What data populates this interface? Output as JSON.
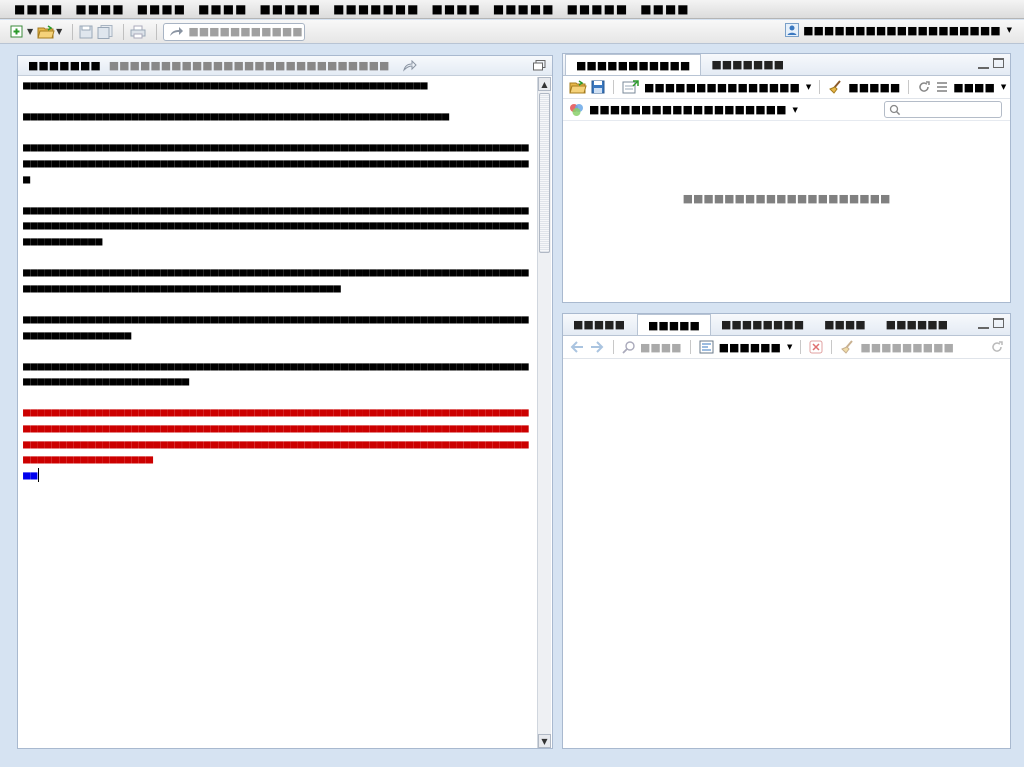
{
  "menubar": {
    "items": [
      "■■■■",
      "■■■■",
      "■■■■",
      "■■■■",
      "■■■■■",
      "■■■■■■■",
      "■■■■",
      "■■■■■",
      "■■■■■",
      "■■■■"
    ]
  },
  "toolbar": {
    "search_placeholder": "■■■■■■■■■■■",
    "user_label": "■■■■■■■■■■■■■■■■■■■"
  },
  "editor": {
    "title": "■■■■■■■",
    "subtitle": "■■■■■■■■■■■■■■■■■■■■■■■■■■■",
    "paragraphs": [
      "■■■■■■■■■■■■■■■■■■■■■■■■■■■■■■■■■■■■■■■■■■■■■■■■■■■■■■■■",
      "■■■■■■■■■■■■■■■■■■■■■■■■■■■■■■■■■■■■■■■■■■■■■■■■■■■■■■■■■■■",
      "■■■■■■■■■■■■■■■■■■■■■■■■■■■■■■■■■■■■■■■■■■■■■■■■■■■■■■■■■■■■■■■■■■■■■■■■■■■■■■■■■■■■■■■■■■■■■■■■■■■■■■■■■■■■■■■■■■■■■■■■■■■■■■■■■■■■■■■■■■■■■",
      "■■■■■■■■■■■■■■■■■■■■■■■■■■■■■■■■■■■■■■■■■■■■■■■■■■■■■■■■■■■■■■■■■■■■■■■■■■■■■■■■■■■■■■■■■■■■■■■■■■■■■■■■■■■■■■■■■■■■■■■■■■■■■■■■■■■■■■■■■■■■■■■■■■■■■■■",
      "■■■■■■■■■■■■■■■■■■■■■■■■■■■■■■■■■■■■■■■■■■■■■■■■■■■■■■■■■■■■■■■■■■■■■■■■■■■■■■■■■■■■■■■■■■■■■■■■■■■■■■■■■■■■■■■■■■",
      "■■■■■■■■■■■■■■■■■■■■■■■■■■■■■■■■■■■■■■■■■■■■■■■■■■■■■■■■■■■■■■■■■■■■■■■■■■■■■■■■■■■■■",
      "■■■■■■■■■■■■■■■■■■■■■■■■■■■■■■■■■■■■■■■■■■■■■■■■■■■■■■■■■■■■■■■■■■■■■■■■■■■■■■■■■■■■■■■■■■■■■"
    ],
    "red_paragraph": "■■■■■■■■■■■■■■■■■■■■■■■■■■■■■■■■■■■■■■■■■■■■■■■■■■■■■■■■■■■■■■■■■■■■■■■■■■■■■■■■■■■■■■■■■■■■■■■■■■■■■■■■■■■■■■■■■■■■■■■■■■■■■■■■■■■■■■■■■■■■■■■■■■■■■■■■■■■■■■■■■■■■■■■■■■■■■■■■■■■■■■■■■■■■■■■■■■■■■■■■■■■■■■■■■■■■■■■■■■■■■■■■■■■■",
    "blue_text": "■■"
  },
  "top_right": {
    "tabs": [
      "■■■■■■■■■■■",
      "■■■■■■■"
    ],
    "action_label": "■■■■■■■■■■■■■■■",
    "clear_label": "■■■■■",
    "view_label": "■■■■",
    "filter_label": "■■■■■■■■■■■■■■■■■■■",
    "empty_message": "■■■■■■■■■■■■■■■■■■■■"
  },
  "bottom_right": {
    "tabs": [
      "■■■■■",
      "■■■■■",
      "■■■■■■■■",
      "■■■■",
      "■■■■■■"
    ],
    "zoom_label": "■■■■",
    "format_label": "■■■■■■",
    "clear_label": "■■■■■■■■■"
  },
  "colors": {
    "accent": "#1e6fcc",
    "red_text": "#cc0000",
    "blue_text": "#0000ee"
  }
}
